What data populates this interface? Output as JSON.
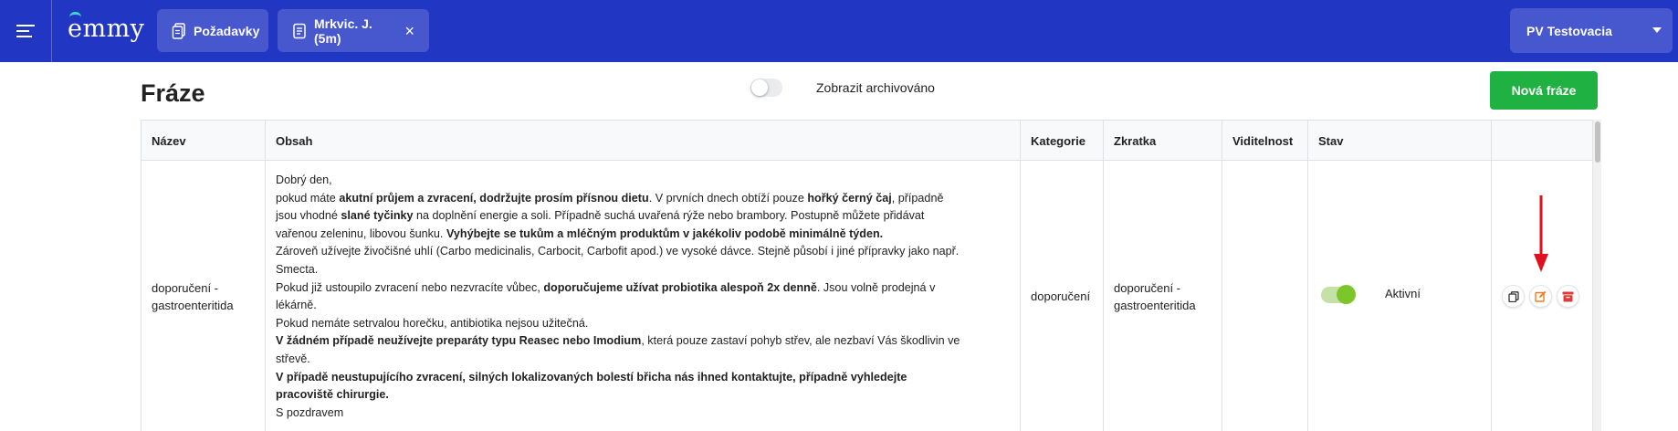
{
  "app": {
    "logo_text": "emmy"
  },
  "header": {
    "tabs": [
      {
        "label": "Požadavky",
        "icon": "clipboard-icon",
        "closable": false
      },
      {
        "label": "Mrkvic. J. (5m)",
        "icon": "document-icon",
        "closable": true
      }
    ],
    "close_glyph": "×",
    "user_select": {
      "value": "PV Testovacia"
    }
  },
  "page": {
    "title": "Fráze",
    "archive_toggle_label": "Zobrazit archivováno",
    "archive_toggle_on": false,
    "new_button_label": "Nová fráze"
  },
  "table": {
    "columns": [
      "Název",
      "Obsah",
      "Kategorie",
      "Zkratka",
      "Viditelnost",
      "Stav",
      ""
    ],
    "rows": [
      {
        "name_line1": "doporučení -",
        "name_line2": "gastroenteritida",
        "content": [
          [
            {
              "t": "Dobrý den,"
            }
          ],
          [
            {
              "t": "pokud máte "
            },
            {
              "t": "akutní průjem a zvracení, dodržujte prosím přísnou dietu",
              "b": true
            },
            {
              "t": ". V prvních dnech obtíží pouze "
            },
            {
              "t": "hořký černý čaj",
              "b": true
            },
            {
              "t": ", případně"
            }
          ],
          [
            {
              "t": "jsou vhodné "
            },
            {
              "t": "slané tyčinky",
              "b": true
            },
            {
              "t": " na doplnění energie a soli. Případně suchá uvařená rýže nebo brambory. Postupně můžete přidávat"
            }
          ],
          [
            {
              "t": "vařenou zeleninu, libovou šunku. "
            },
            {
              "t": "Vyhýbejte se tukům a mléčným produktům v jakékoliv podobě minimálně týden.",
              "b": true
            }
          ],
          [
            {
              "t": "Zároveň užívejte živočišné uhlí (Carbo medicinalis, Carbocit, Carbofit apod.) ve vysoké dávce. Stejně působí i jiné přípravky jako např."
            }
          ],
          [
            {
              "t": "Smecta."
            }
          ],
          [
            {
              "t": "Pokud již ustoupilo zvracení nebo nezvracíte vůbec, "
            },
            {
              "t": "doporučujeme užívat probiotika alespoň 2x denně",
              "b": true
            },
            {
              "t": ". Jsou volně prodejná v"
            }
          ],
          [
            {
              "t": "lékárně."
            }
          ],
          [
            {
              "t": "Pokud nemáte setrvalou horečku, antibiotika nejsou užitečná."
            }
          ],
          [
            {
              "t": "V žádném případě neužívejte preparáty typu Reasec nebo Imodium",
              "b": true
            },
            {
              "t": ", která pouze zastaví pohyb střev, ale nezbaví Vás škodlivin ve"
            }
          ],
          [
            {
              "t": "střevě."
            }
          ],
          [
            {
              "t": "V případě neustupujícího zvracení, silných lokalizovaných bolestí břicha nás ihned kontaktujte, případně vyhledejte",
              "b": true
            }
          ],
          [
            {
              "t": "pracoviště chirurgie.",
              "b": true
            }
          ],
          [
            {
              "t": "S pozdravem"
            }
          ]
        ],
        "category": "doporučení",
        "shortcut_line1": "doporučení -",
        "shortcut_line2": "gastroenteritida",
        "visibility": "",
        "status_on": true,
        "status_label": "Aktivní",
        "actions": [
          {
            "name": "copy-icon",
            "color": "#333333"
          },
          {
            "name": "edit-icon",
            "color": "#f07c22"
          },
          {
            "name": "archive-icon",
            "color": "#e03b3b"
          }
        ]
      }
    ]
  },
  "colors": {
    "topbar": "#2236c4",
    "primary_button": "#1fb141",
    "toggle_active": "#7cc62b",
    "annotation_arrow": "#e0101e"
  }
}
